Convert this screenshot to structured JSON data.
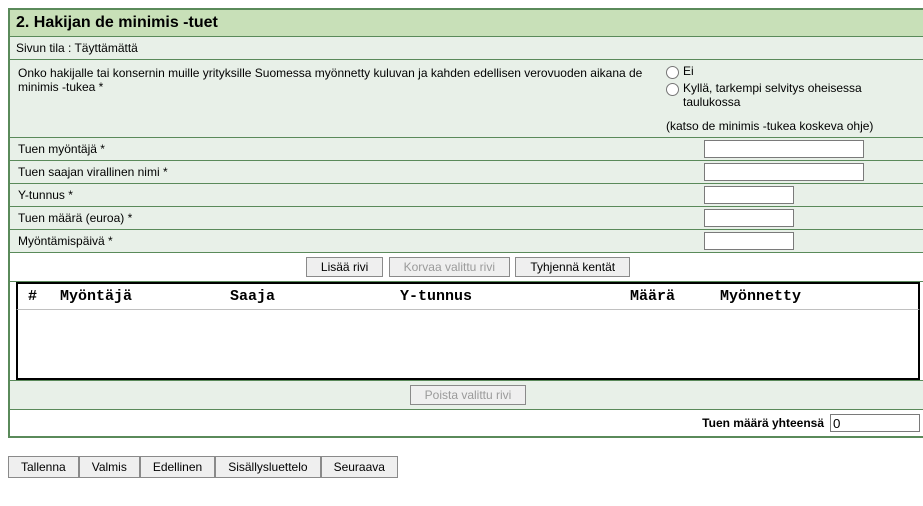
{
  "section_title": "2. Hakijan de minimis -tuet",
  "page_state_label": "Sivun tila : Täyttämättä",
  "question": {
    "label": "Onko hakijalle tai konsernin muille yrityksille Suomessa myönnetty kuluvan ja kahden edellisen verovuoden aikana de minimis -tukea *",
    "option_no": "Ei",
    "option_yes": "Kyllä, tarkempi selvitys oheisessa taulukossa",
    "hint": "(katso de minimis -tukea koskeva ohje)"
  },
  "fields": {
    "grantor": "Tuen myöntäjä *",
    "recipient_name": "Tuen saajan virallinen nimi *",
    "business_id": "Y-tunnus *",
    "amount": "Tuen määrä (euroa) *",
    "grant_date": "Myöntämispäivä *"
  },
  "buttons": {
    "add_row": "Lisää rivi",
    "replace_row": "Korvaa valittu rivi",
    "clear_fields": "Tyhjennä kentät",
    "delete_row": "Poista valittu rivi"
  },
  "grid": {
    "col_idx": "#",
    "col_grantor": "Myöntäjä",
    "col_recipient": "Saaja",
    "col_business_id": "Y-tunnus",
    "col_amount": "Määrä",
    "col_granted": "Myönnetty"
  },
  "total": {
    "label": "Tuen määrä yhteensä",
    "value": "0"
  },
  "footer": {
    "save": "Tallenna",
    "ready": "Valmis",
    "prev": "Edellinen",
    "toc": "Sisällysluettelo",
    "next": "Seuraava"
  }
}
